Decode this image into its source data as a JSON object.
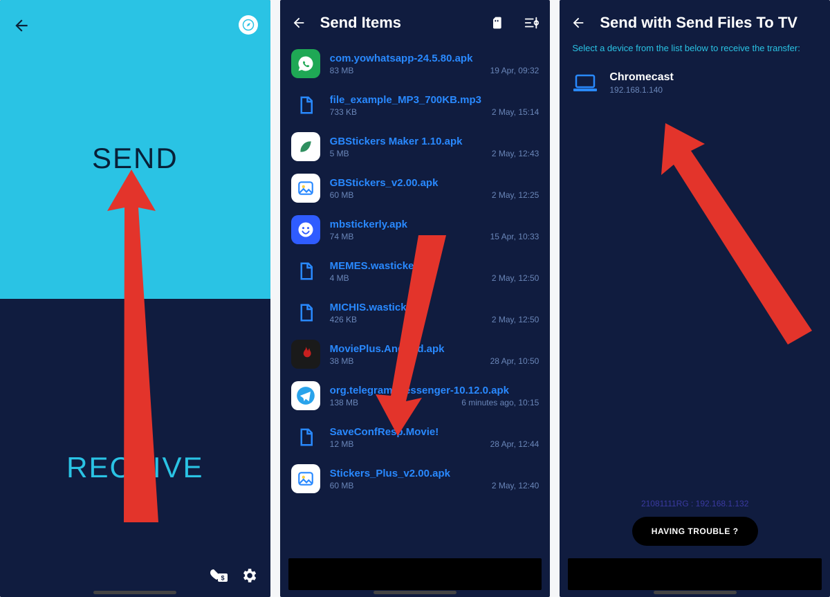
{
  "panel1": {
    "send_label": "SEND",
    "receive_label": "RECEIVE"
  },
  "panel2": {
    "title": "Send Items",
    "files": [
      {
        "name": "com.yowhatsapp-24.5.80.apk",
        "size": "83 MB",
        "date": "19 Apr, 09:32",
        "icon": "whatsapp",
        "bg": "#1fa855",
        "fg": "#fff"
      },
      {
        "name": "file_example_MP3_700KB.mp3",
        "size": "733 KB",
        "date": "2 May, 15:14",
        "icon": "doc",
        "bg": "transparent",
        "fg": "#2989ff"
      },
      {
        "name": "GBStickers Maker 1.10.apk",
        "size": "5 MB",
        "date": "2 May, 12:43",
        "icon": "leaf",
        "bg": "#fff",
        "fg": "#2f8f5f"
      },
      {
        "name": "GBStickers_v2.00.apk",
        "size": "60 MB",
        "date": "2 May, 12:25",
        "icon": "image",
        "bg": "#fff",
        "fg": "#2989ff"
      },
      {
        "name": "mbstickerly.apk",
        "size": "74 MB",
        "date": "15 Apr, 10:33",
        "icon": "smile",
        "bg": "#2f5cff",
        "fg": "#fff"
      },
      {
        "name": "MEMES.wastickers",
        "size": "4 MB",
        "date": "2 May, 12:50",
        "icon": "doc",
        "bg": "transparent",
        "fg": "#2989ff"
      },
      {
        "name": "MICHIS.wastickers",
        "size": "426 KB",
        "date": "2 May, 12:50",
        "icon": "doc",
        "bg": "transparent",
        "fg": "#2989ff"
      },
      {
        "name": "MoviePlus.Android.apk",
        "size": "38 MB",
        "date": "28 Apr, 10:50",
        "icon": "flame",
        "bg": "#1a1a1a",
        "fg": "#c81f1f"
      },
      {
        "name": "org.telegram.messenger-10.12.0.apk",
        "size": "138 MB",
        "date": "6 minutes ago, 10:15",
        "icon": "telegram",
        "bg": "#fff",
        "fg": "#29a3eb"
      },
      {
        "name": "SaveConfResp.Movie!",
        "size": "12 MB",
        "date": "28 Apr, 12:44",
        "icon": "doc",
        "bg": "transparent",
        "fg": "#2989ff"
      },
      {
        "name": "Stickers_Plus_v2.00.apk",
        "size": "60 MB",
        "date": "2 May, 12:40",
        "icon": "image",
        "bg": "#fff",
        "fg": "#2989ff"
      }
    ]
  },
  "panel3": {
    "title": "Send with Send Files To TV",
    "instruction": "Select a device from the list below to receive the transfer:",
    "device": {
      "name": "Chromecast",
      "ip": "192.168.1.140"
    },
    "own_ip": "21081111RG : 192.168.1.132",
    "trouble_label": "HAVING TROUBLE ?"
  }
}
